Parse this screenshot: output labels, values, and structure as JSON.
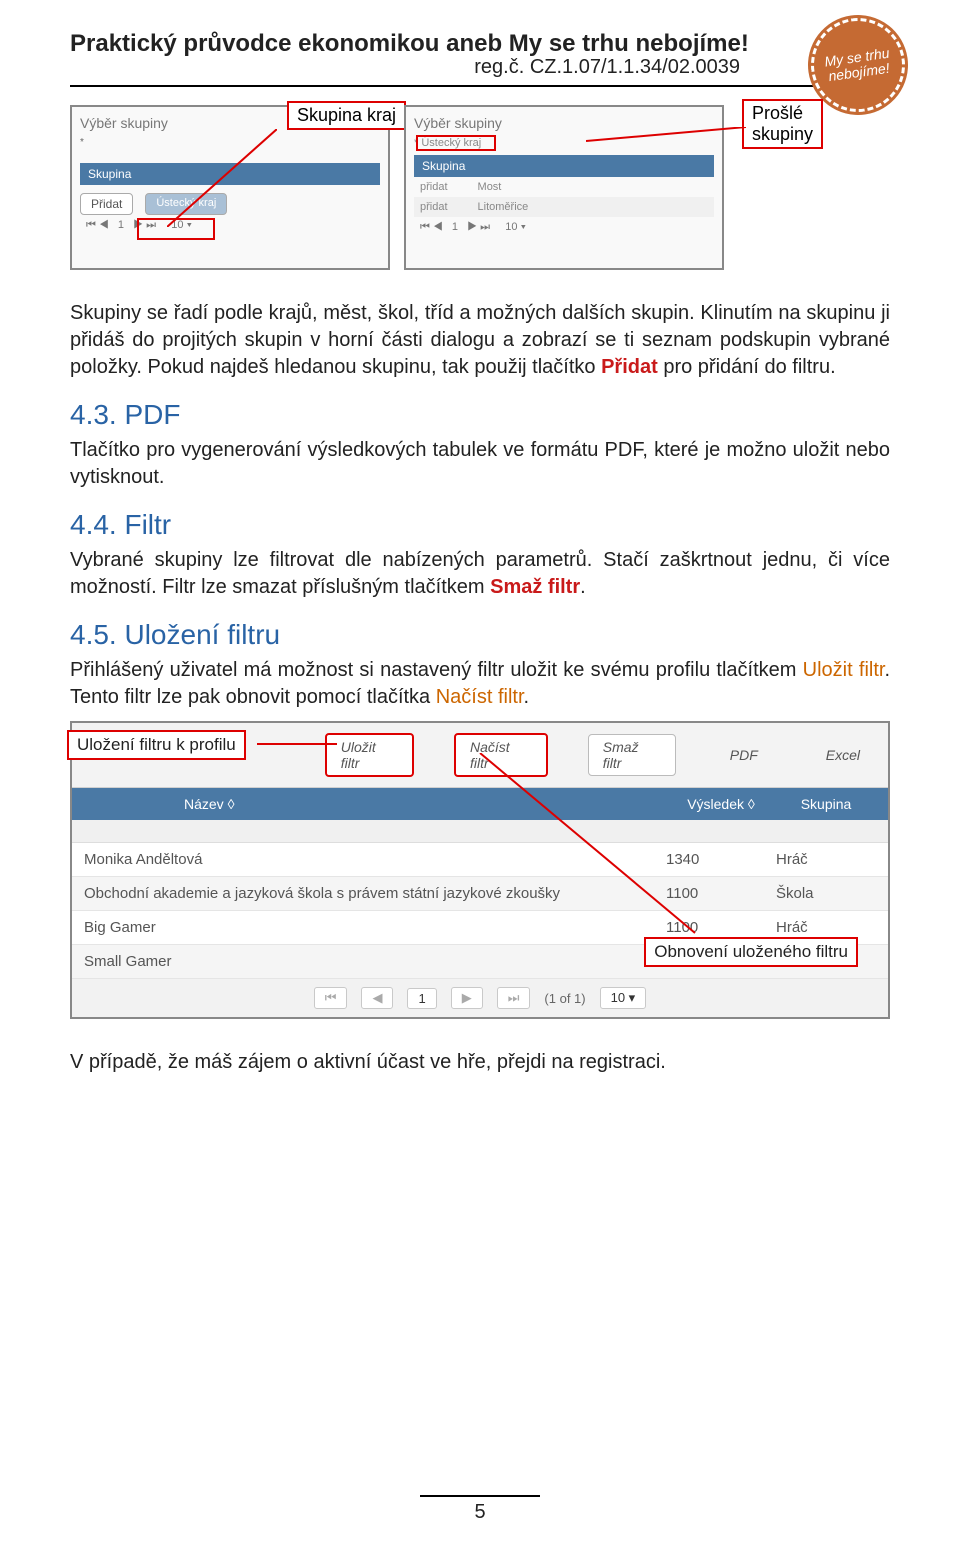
{
  "header": {
    "title": "Praktický průvodce ekonomikou aneb My se trhu nebojíme!",
    "reg": "reg.č. CZ.1.07/1.1.34/02.0039",
    "badge": "My se trhu nebojíme!"
  },
  "fig1": {
    "title": "Výběr skupiny",
    "bluebar": "Skupina",
    "btn_pridat": "Přidat",
    "highlight": "Ústecký kraj",
    "annotation": "Skupina kraj"
  },
  "fig2": {
    "title": "Výběr skupiny",
    "sub": "* Ústecký kraj",
    "bluebar": "Skupina",
    "r1a": "přidat",
    "r1b": "Most",
    "r2a": "přidat",
    "r2b": "Litoměřice",
    "annotation": "Prošlé skupiny"
  },
  "p1_a": "Skupiny se řadí podle krajů, měst, škol, tříd a možných dalších skupin. Klinutím na skupinu ji přidáš do projitých skupin v horní části dialogu a zobrazí se ti seznam podskupin vybrané položky. Pokud najdeš hledanou skupinu, tak použij tlačítko ",
  "p1_red": "Přidat",
  "p1_b": " pro přidání do filtru.",
  "h43": "4.3. PDF",
  "p43": "Tlačítko pro vygenerování výsledkových tabulek ve formátu PDF, které je možno uložit nebo vytisknout.",
  "h44": "4.4. Filtr",
  "p44_a": "Vybrané skupiny lze filtrovat dle nabízených parametrů. Stačí zaškrtnout jednu, či více možností. Filtr lze smazat příslušným tlačítkem ",
  "p44_red": "Smaž filtr",
  "p44_b": ".",
  "h45": "4.5. Uložení filtru",
  "p45_a": "Přihlášený uživatel má možnost si nastavený filtr uložit ke svému profilu tlačítkem ",
  "p45_or1": "Uložit filtr",
  "p45_b": ". Tento filtr lze pak obnovit pomocí tlačítka ",
  "p45_or2": "Načíst filtr",
  "p45_c": ".",
  "tableFig": {
    "annotation_left": "Uložení filtru k profilu",
    "annotation_right": "Obnovení uloženého filtru",
    "btn_ulozit": "Uložit filtr",
    "btn_nacist": "Načíst filtr",
    "btn_smaz": "Smaž filtr",
    "btn_pdf": "PDF",
    "btn_excel": "Excel",
    "col_name": "Název ◊",
    "col_v": "Výsledek ◊",
    "col_g": "Skupina",
    "rows": [
      {
        "name": "Monika Anděltová",
        "v": "1340",
        "g": "Hráč"
      },
      {
        "name": "Obchodní akademie a jazyková škola s právem státní jazykové zkoušky",
        "v": "1100",
        "g": "Škola"
      },
      {
        "name": "Big Gamer",
        "v": "1100",
        "g": "Hráč"
      },
      {
        "name": "Small Gamer",
        "v": "",
        "g": ""
      }
    ],
    "pager": {
      "first": "⏮",
      "prev": "◀",
      "page": "1",
      "next": "▶",
      "last": "⏭",
      "of": "(1 of 1)",
      "per": "10 ▾"
    }
  },
  "closing": "V případě, že máš zájem o aktivní účast ve hře, přejdi na registraci.",
  "pageNum": "5"
}
